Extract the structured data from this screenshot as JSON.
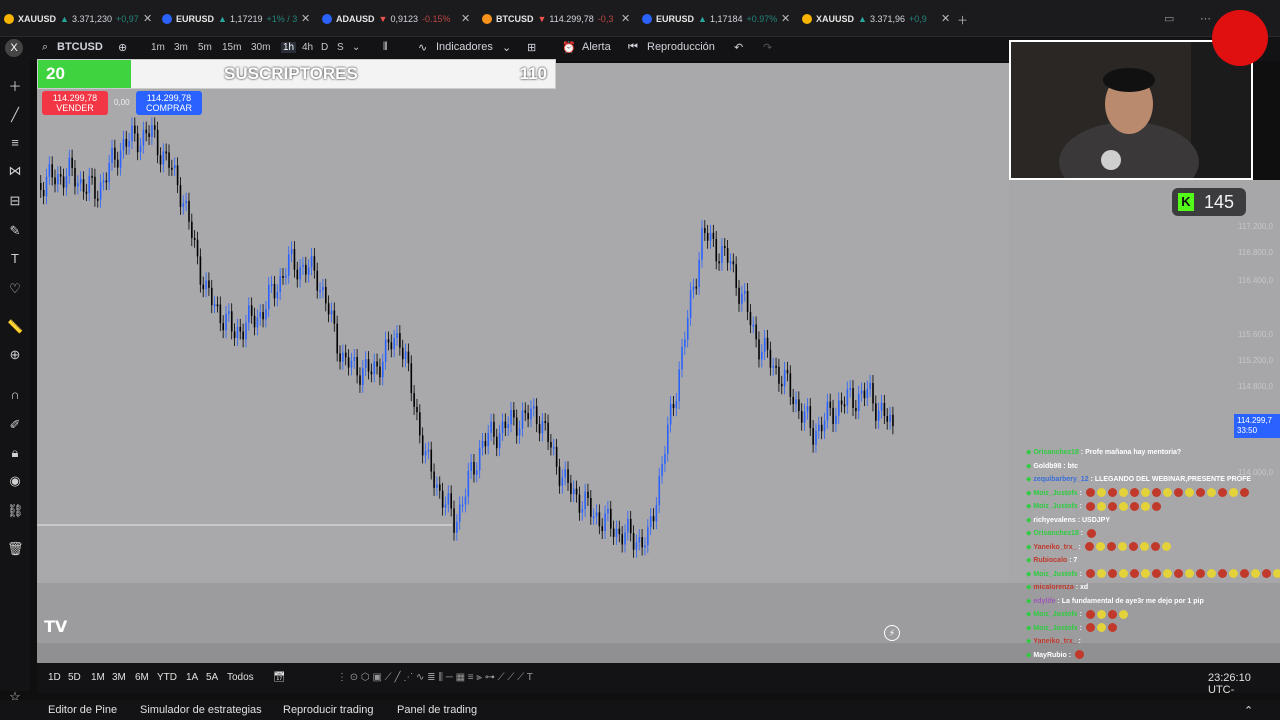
{
  "tabs": [
    {
      "symbol": "XAUUSD",
      "dir": "up",
      "price": "3.371,230",
      "change": "+0,97",
      "color": "#f7b500"
    },
    {
      "symbol": "EURUSD",
      "dir": "up",
      "price": "1,17219",
      "change": "+1% / 3",
      "color": "#2962ff"
    },
    {
      "symbol": "ADAUSD",
      "dir": "dn",
      "price": "0,9123",
      "change": "-0.15%",
      "color": "#2962ff"
    },
    {
      "symbol": "BTCUSD",
      "dir": "dn",
      "price": "114.299,78",
      "change": "-0,3",
      "color": "#f7931a"
    },
    {
      "symbol": "EURUSD",
      "dir": "up",
      "price": "1,17184",
      "change": "+0.97%",
      "color": "#2962ff"
    },
    {
      "symbol": "XAUUSD",
      "dir": "up",
      "price": "3.371,96",
      "change": "+0,9",
      "color": "#f7b500"
    }
  ],
  "toolbar": {
    "symbol": "BTCUSD",
    "intervals": [
      "1m",
      "3m",
      "5m",
      "15m",
      "30m",
      "1h",
      "4h",
      "D",
      "S"
    ],
    "indicators": "Indicadores",
    "alert": "Alerta",
    "replay": "Reproducción"
  },
  "subs": {
    "current": "20",
    "label": "SUSCRIPTORES",
    "goal": "110",
    "progress_fraction": 0.18
  },
  "trade": {
    "sell_price": "114.299,78",
    "sell_label": "VENDER",
    "spread": "0,00",
    "buy_price": "114.299,78",
    "buy_label": "COMPRAR"
  },
  "kick": {
    "viewers": "145"
  },
  "price_tag": {
    "price": "114.299,7",
    "countdown": "33:50"
  },
  "right_axis": [
    "117.200,0",
    "116.800,0",
    "116.400,0",
    "115.600,0",
    "115.200,0",
    "114.800,0",
    "114.000,0"
  ],
  "chat": [
    {
      "user": "Orisanchez18",
      "text": "Profe mañana hay mentoria?",
      "color": "#2ecc40",
      "emotes": 0
    },
    {
      "user": "Goldb98",
      "text": "btc",
      "color": "#ffffff",
      "emotes": 0
    },
    {
      "user": "zequibarbery_12",
      "text": "LLEGANDO DEL WEBINAR,PRESENTE PROFE",
      "color": "#3a6fd8",
      "emotes": 0
    },
    {
      "user": "Moiz_Justofx",
      "text": "",
      "color": "#2ecc40",
      "emotes": 15
    },
    {
      "user": "Moiz_Justofx",
      "text": "",
      "color": "#2ecc40",
      "emotes": 7
    },
    {
      "user": "richyevalens",
      "text": "USDJPY",
      "color": "#ffffff",
      "emotes": 0
    },
    {
      "user": "Orisanchez18",
      "text": "",
      "color": "#2ecc40",
      "emotes": 1
    },
    {
      "user": "Yaneiko_trx_",
      "text": "",
      "color": "#c0392b",
      "emotes": 8
    },
    {
      "user": "Rubiocalo",
      "text": "7",
      "color": "#c0392b",
      "emotes": 0
    },
    {
      "user": "Moiz_Justofx",
      "text": "",
      "color": "#2ecc40",
      "emotes": 18
    },
    {
      "user": "micalorenza",
      "text": "xd",
      "color": "#c0392b",
      "emotes": 0
    },
    {
      "user": "edylife",
      "text": "La fundamental de aye3r me dejo por 1 pip",
      "color": "#9b59b6",
      "emotes": 0
    },
    {
      "user": "Moiz_Justofx",
      "text": "",
      "color": "#2ecc40",
      "emotes": 4
    },
    {
      "user": "Moiz_Justofx",
      "text": "",
      "color": "#2ecc40",
      "emotes": 3
    },
    {
      "user": "Yaneiko_trx_",
      "text": "",
      "color": "#c0392b",
      "emotes": 0
    },
    {
      "user": "MayRubio",
      "text": "",
      "color": "#ffffff",
      "emotes": 1
    }
  ],
  "ranges": [
    "1D",
    "5D",
    "1M",
    "3M",
    "6M",
    "YTD",
    "1A",
    "5A",
    "Todos"
  ],
  "clock": "23:26:10 UTC-",
  "bottom": [
    "Editor de Pine",
    "Simulador de estrategias",
    "Reproducir trading",
    "Panel de trading"
  ],
  "colors": {
    "accent": "#2962ff",
    "up": "#2962ff",
    "down": "#000000",
    "kick": "#53fc18"
  }
}
